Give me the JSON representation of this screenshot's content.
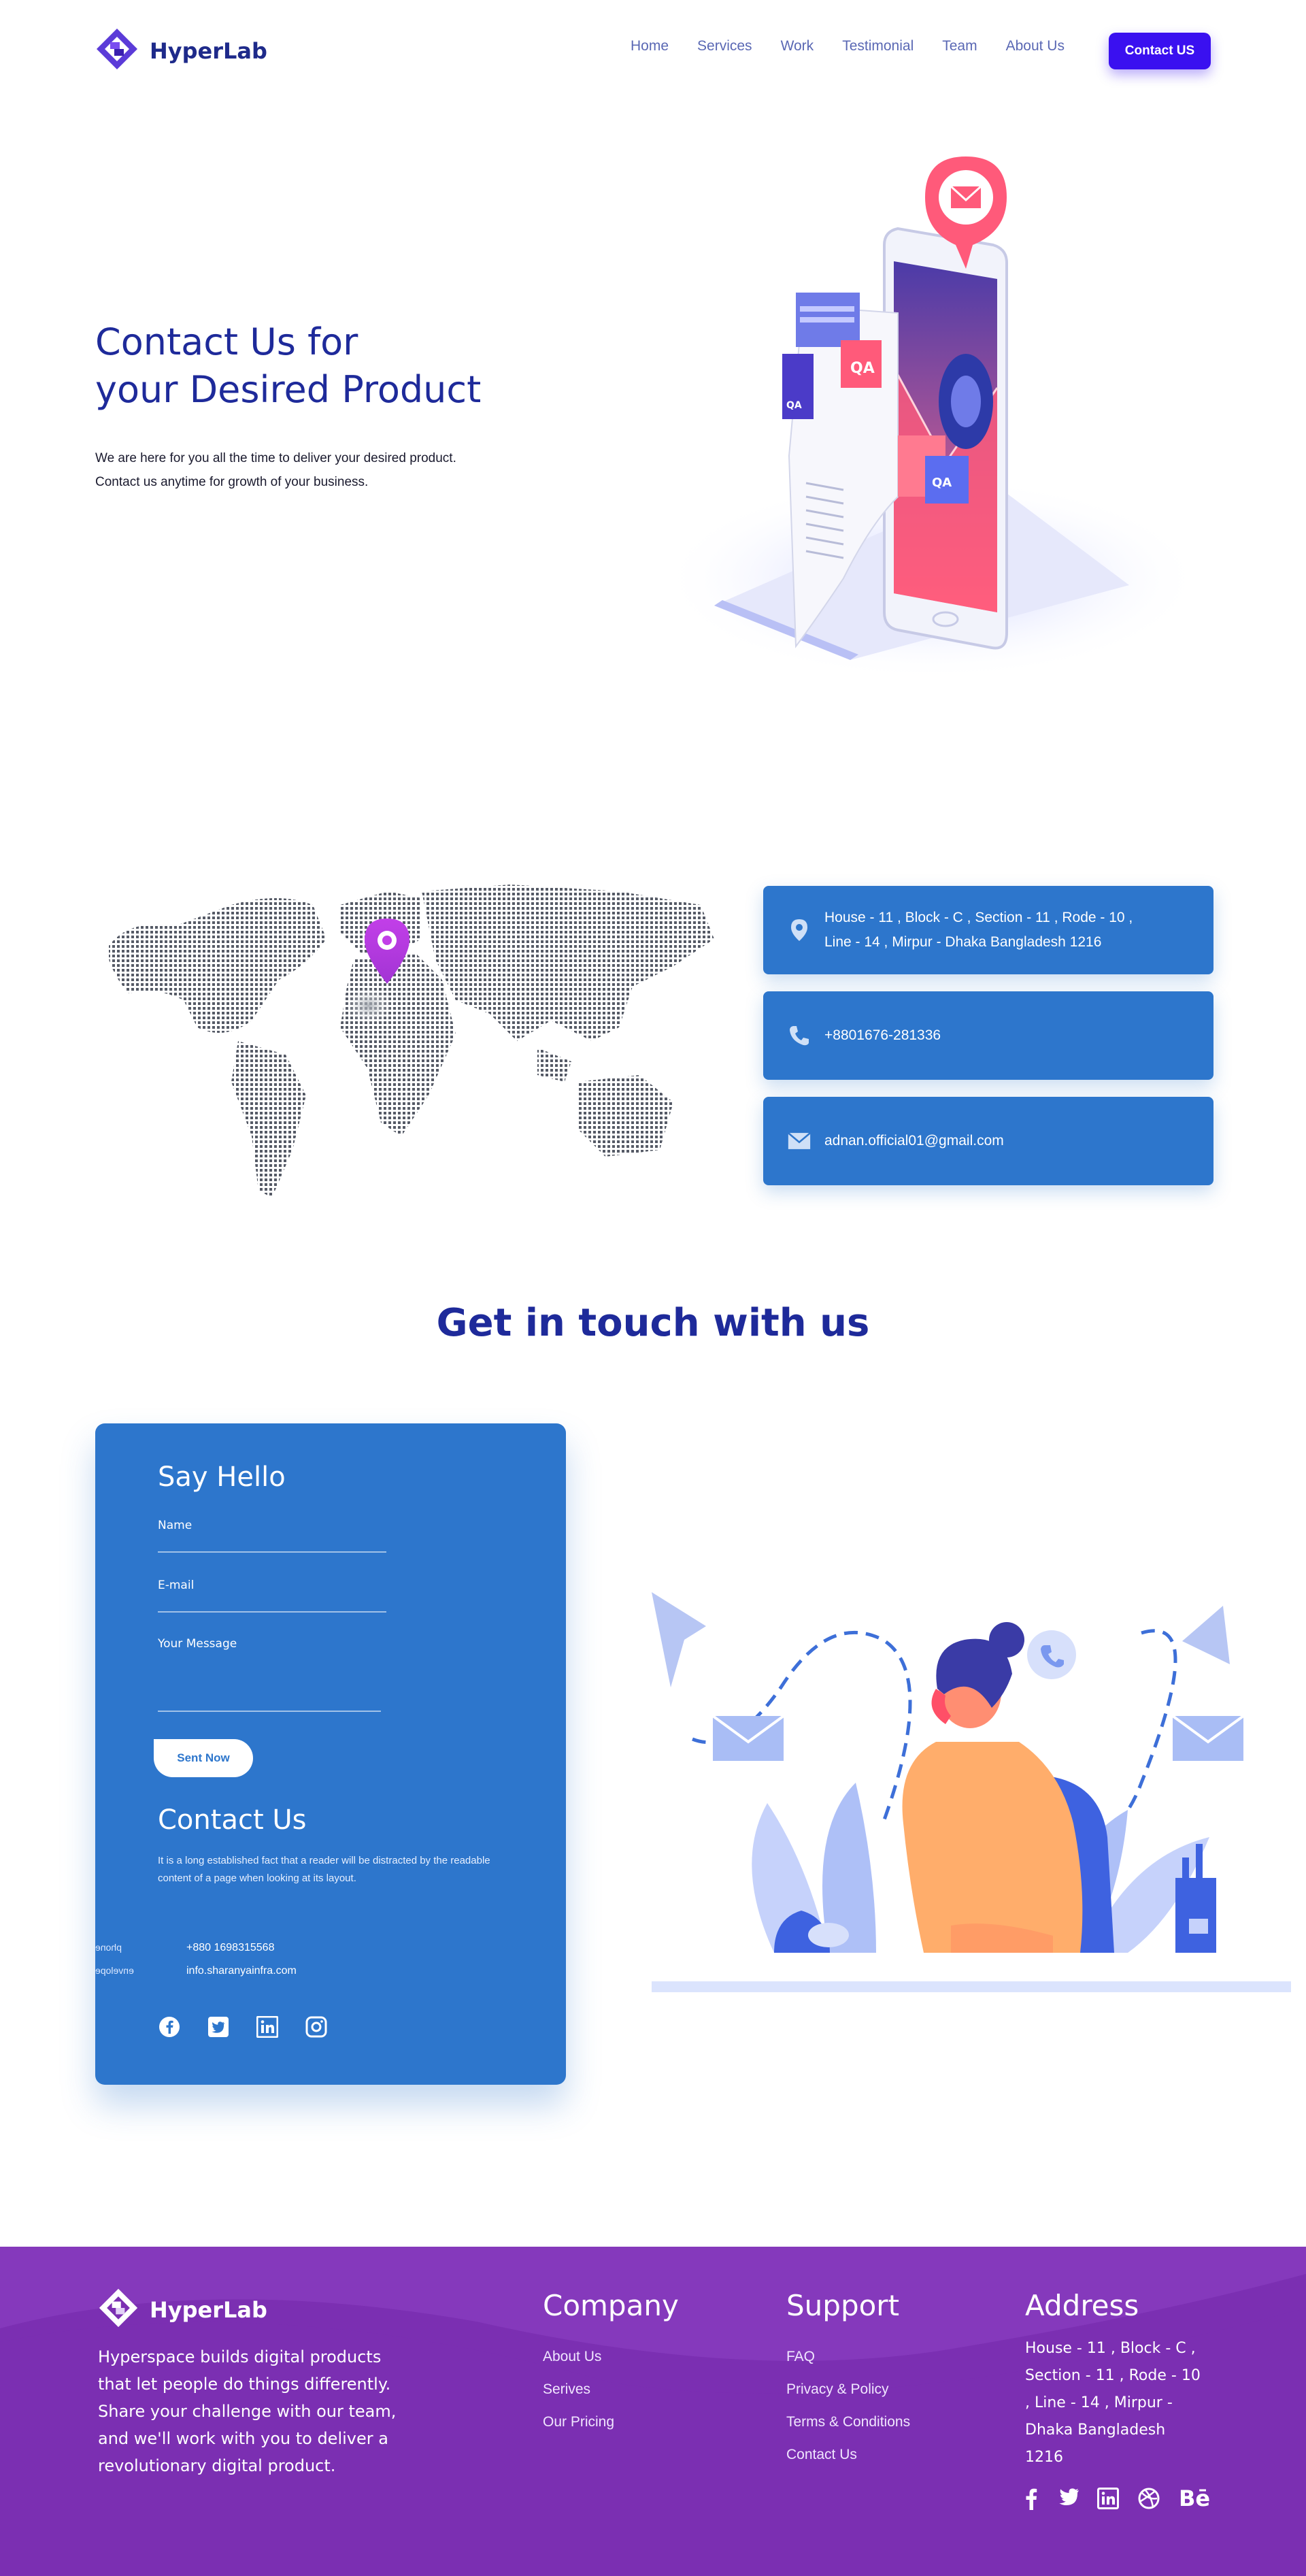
{
  "header": {
    "brand": "HyperLab",
    "nav": [
      "Home",
      "Services",
      "Work",
      "Testimonial",
      "Team",
      "About Us"
    ],
    "cta": "Contact US"
  },
  "hero": {
    "title_line1": "Contact Us for",
    "title_line2": "your Desired Product",
    "description": "We are here for you all the time to deliver your desired product. Contact us anytime for growth of your business."
  },
  "contact_info": {
    "address_line1": "House - 11 , Block - C , Section - 11 , Rode - 10 ,",
    "address_line2": "Line - 14 , Mirpur - Dhaka Bangladesh 1216",
    "phone": "+8801676-281336",
    "email": "adnan.official01@gmail.com"
  },
  "touch": {
    "title": "Get in touch with us"
  },
  "form": {
    "title": "Say Hello",
    "name_label": "Name",
    "email_label": "E-mail",
    "message_label": "Your Message",
    "submit": "Sent Now",
    "contact_title": "Contact Us",
    "contact_text": "It is a long established fact that a reader will be distracted by the readable content of a page when looking at its layout.",
    "phone_key": "phone",
    "phone_value": "+880 1698315568",
    "email_key": "envelope",
    "email_value": "info.sharanyainfra.com"
  },
  "footer": {
    "brand": "HyperLab",
    "description": "Hyperspace builds digital products that let people do things differently. Share your challenge with our team, and we'll work with you to deliver a revolutionary digital product.",
    "company_title": "Company",
    "company_links": [
      "About Us",
      "Serives",
      "Our Pricing"
    ],
    "support_title": "Support",
    "support_links": [
      "FAQ",
      "Privacy & Policy",
      "Terms & Conditions",
      "Contact Us"
    ],
    "address_title": "Address",
    "address": "House - 11 , Block - C , Section - 11 , Rode - 10 , Line - 14 , Mirpur - Dhaka Bangladesh 1216",
    "social_behance": "Bē"
  },
  "colors": {
    "primary": "#1e2a9a",
    "card_blue": "#2d76cc",
    "cta": "#3a10f0",
    "footer_purple": "#7b2fb2",
    "pin_magenta": "#c23fe8"
  },
  "icons": [
    "logo-icon",
    "pin-icon",
    "phone-icon",
    "mail-icon",
    "facebook-icon",
    "twitter-icon",
    "linkedin-icon",
    "instagram-icon",
    "dribbble-icon",
    "behance-icon"
  ]
}
